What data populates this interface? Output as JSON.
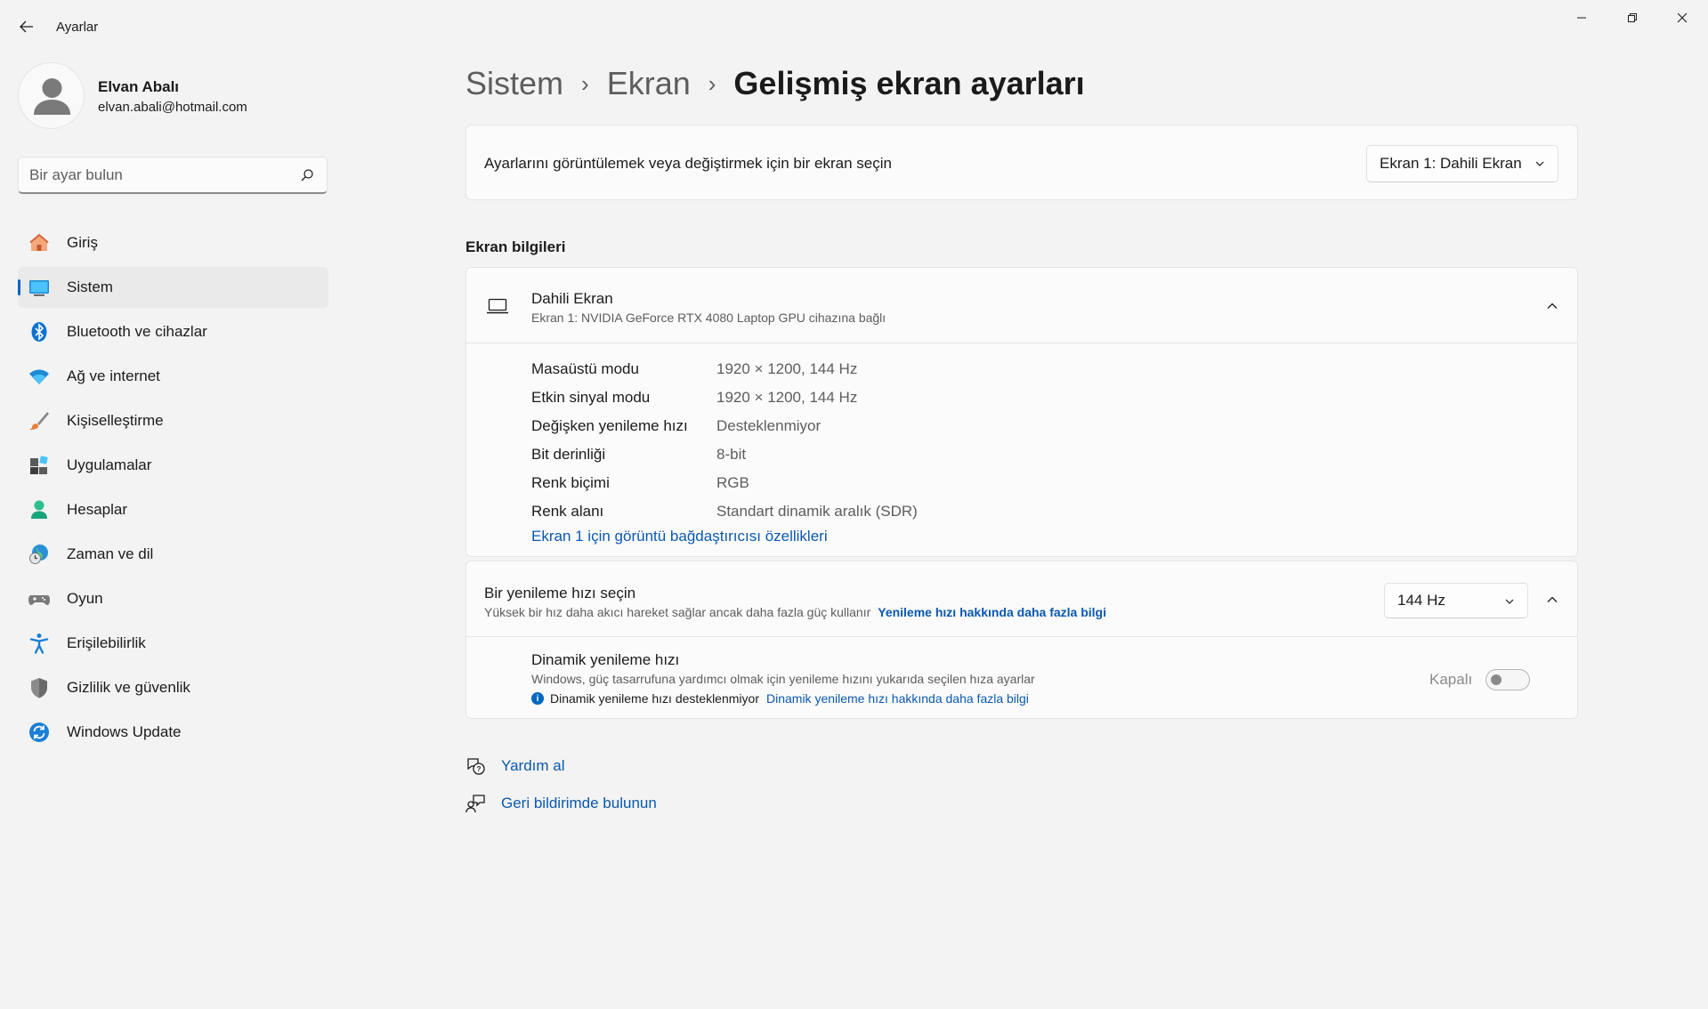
{
  "window": {
    "title": "Ayarlar"
  },
  "profile": {
    "name": "Elvan Abalı",
    "email": "elvan.abali@hotmail.com"
  },
  "search": {
    "placeholder": "Bir ayar bulun"
  },
  "sidebar": {
    "items": [
      {
        "label": "Giriş",
        "icon": "home-icon"
      },
      {
        "label": "Sistem",
        "icon": "system-icon",
        "active": true
      },
      {
        "label": "Bluetooth ve cihazlar",
        "icon": "bluetooth-icon"
      },
      {
        "label": "Ağ ve internet",
        "icon": "wifi-icon"
      },
      {
        "label": "Kişiselleştirme",
        "icon": "brush-icon"
      },
      {
        "label": "Uygulamalar",
        "icon": "apps-icon"
      },
      {
        "label": "Hesaplar",
        "icon": "account-icon"
      },
      {
        "label": "Zaman ve dil",
        "icon": "globe-clock-icon"
      },
      {
        "label": "Oyun",
        "icon": "gamepad-icon"
      },
      {
        "label": "Erişilebilirlik",
        "icon": "accessibility-icon"
      },
      {
        "label": "Gizlilik ve güvenlik",
        "icon": "shield-icon"
      },
      {
        "label": "Windows Update",
        "icon": "update-icon"
      }
    ]
  },
  "breadcrumb": {
    "items": [
      "Sistem",
      "Ekran"
    ],
    "current": "Gelişmiş ekran ayarları"
  },
  "display_select": {
    "label": "Ayarlarını görüntülemek veya değiştirmek için bir ekran seçin",
    "selected": "Ekran 1: Dahili Ekran"
  },
  "display_info": {
    "section_title": "Ekran bilgileri",
    "title": "Dahili Ekran",
    "subtitle": "Ekran 1: NVIDIA GeForce RTX 4080 Laptop GPU cihazına bağlı",
    "rows": [
      {
        "key": "Masaüstü modu",
        "value": "1920 × 1200, 144 Hz"
      },
      {
        "key": "Etkin sinyal modu",
        "value": "1920 × 1200, 144 Hz"
      },
      {
        "key": "Değişken yenileme hızı",
        "value": "Desteklenmiyor"
      },
      {
        "key": "Bit derinliği",
        "value": "8-bit"
      },
      {
        "key": "Renk biçimi",
        "value": "RGB"
      },
      {
        "key": "Renk alanı",
        "value": "Standart dinamik aralık (SDR)"
      }
    ],
    "adapter_link": "Ekran 1 için görüntü bağdaştırıcısı özellikleri"
  },
  "refresh": {
    "title": "Bir yenileme hızı seçin",
    "subtitle": "Yüksek bir hız daha akıcı hareket sağlar ancak daha fazla güç kullanır",
    "link": "Yenileme hızı hakkında daha fazla bilgi",
    "selected": "144 Hz",
    "dynamic_title": "Dinamik yenileme hızı",
    "dynamic_sub": "Windows, güç tasarrufuna yardımcı olmak için yenileme hızını yukarıda seçilen hıza ayarlar",
    "dynamic_note": "Dinamik yenileme hızı desteklenmiyor",
    "dynamic_link": "Dinamik yenileme hızı hakkında daha fazla bilgi",
    "toggle_label": "Kapalı",
    "toggle_on": false
  },
  "help": {
    "get_help": "Yardım al",
    "feedback": "Geri bildirimde bulunun"
  },
  "colors": {
    "accent": "#0067c0",
    "link": "#0a58b0",
    "background": "#f3f3f3"
  }
}
